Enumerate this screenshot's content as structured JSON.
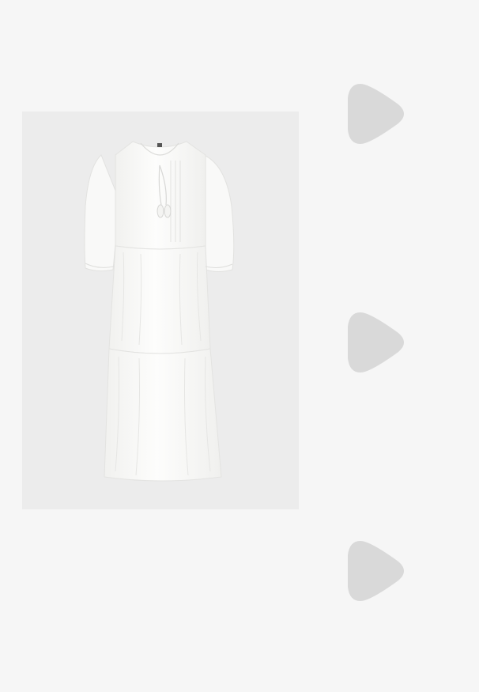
{
  "product": {
    "image_icon": "white-tiered-midi-dress",
    "background_color": "#ececec"
  },
  "carousel_controls": [
    {
      "icon": "play-triangle-icon",
      "color": "#d9d9d9"
    },
    {
      "icon": "play-triangle-icon",
      "color": "#d9d9d9"
    },
    {
      "icon": "play-triangle-icon",
      "color": "#d9d9d9"
    }
  ],
  "colors": {
    "page_background": "#f6f6f6",
    "dress": "#fbfbfa",
    "dress_shadow": "#e4e4e2"
  }
}
